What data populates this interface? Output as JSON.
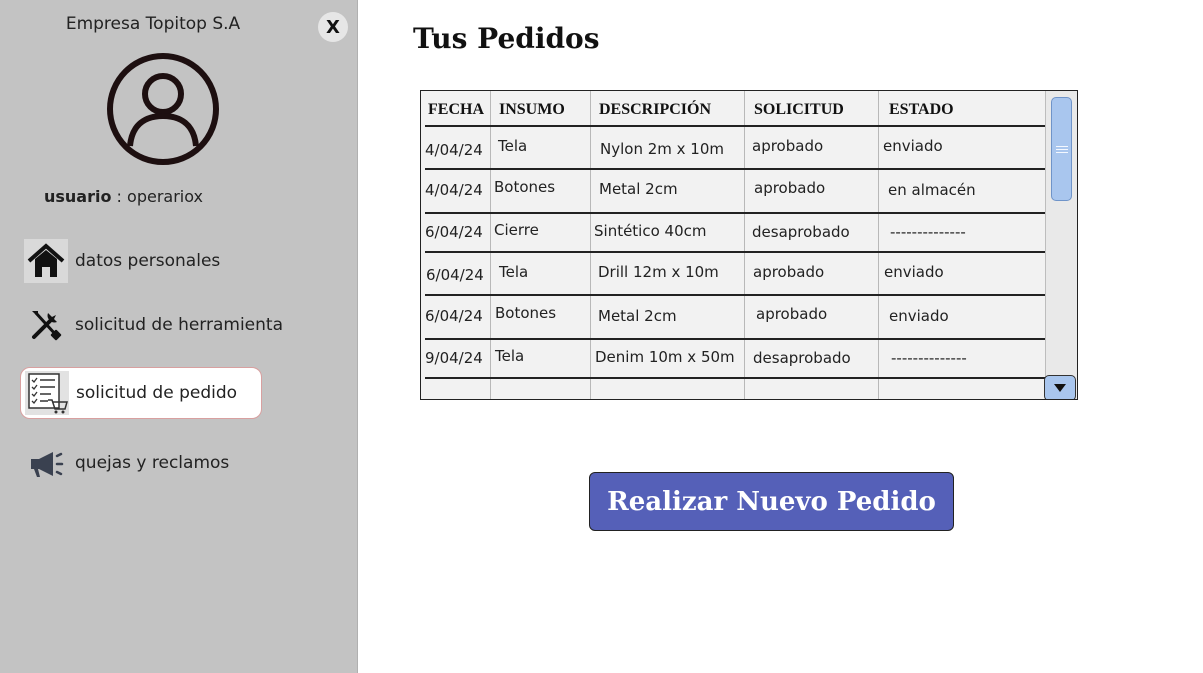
{
  "sidebar": {
    "company": "Empresa Topitop S.A",
    "close_label": "X",
    "user_label": "usuario",
    "user_separator": " : ",
    "user_value": "operariox",
    "items": [
      {
        "label": "datos personales",
        "icon": "home-icon"
      },
      {
        "label": "solicitud de herramienta",
        "icon": "tools-icon"
      },
      {
        "label": "solicitud de pedido",
        "icon": "order-list-cart-icon",
        "active": true
      },
      {
        "label": "quejas y reclamos",
        "icon": "megaphone-icon"
      }
    ]
  },
  "main": {
    "title": "Tus Pedidos",
    "table": {
      "columns": [
        "FECHA",
        "INSUMO",
        "DESCRIPCIÓN",
        "SOLICITUD",
        "ESTADO"
      ],
      "rows": [
        [
          "4/04/24",
          "Tela",
          "Nylon 2m x 10m",
          "aprobado",
          "enviado"
        ],
        [
          "4/04/24",
          "Botones",
          "Metal 2cm",
          "aprobado",
          "en almacén"
        ],
        [
          "6/04/24",
          "Cierre",
          "Sintético 40cm",
          "desaprobado",
          "--------------"
        ],
        [
          "6/04/24",
          "Tela",
          "Drill 12m x 10m",
          "aprobado",
          "enviado"
        ],
        [
          "6/04/24",
          "Botones",
          "Metal 2cm",
          "aprobado",
          "enviado"
        ],
        [
          "9/04/24",
          "Tela",
          "Denim 10m x 50m",
          "desaprobado",
          "--------------"
        ]
      ]
    },
    "cta_label": "Realizar Nuevo Pedido"
  },
  "colors": {
    "sidebar_bg": "#c3c3c3",
    "button_bg": "#5560b8",
    "scroll_accent": "#a9c6ee"
  }
}
